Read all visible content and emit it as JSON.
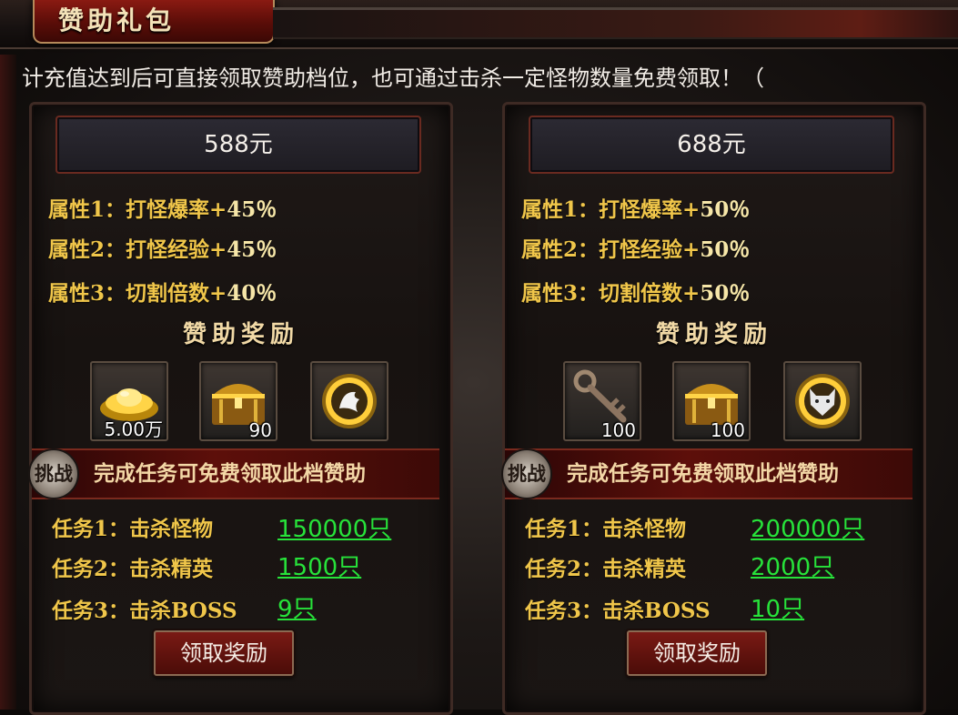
{
  "header": {
    "title": "赞助礼包"
  },
  "notice": "计充值达到后可直接领取赞助档位，也可通过击杀一定怪物数量免费领取！（",
  "tiers": [
    {
      "price": "588元",
      "attrs": [
        {
          "label": "属性1：打怪爆率+",
          "value": "45％"
        },
        {
          "label": "属性2：打怪经验+",
          "value": "45％"
        },
        {
          "label": "属性3：切割倍数+",
          "value": "40％"
        }
      ],
      "reward_title": "赞助奖励",
      "items": [
        {
          "icon": "gold-ingot-icon",
          "count": "5.00万"
        },
        {
          "icon": "treasure-chest-icon",
          "count": "90"
        },
        {
          "icon": "golden-medal-icon",
          "count": ""
        }
      ],
      "challenge_badge": "挑战",
      "challenge_text": "完成任务可免费领取此档赞助",
      "tasks": [
        {
          "label": "任务1：击杀怪物",
          "value": "150000只"
        },
        {
          "label": "任务2：击杀精英",
          "value": "1500只"
        },
        {
          "label": "任务3：击杀BOSS",
          "value": "9只"
        }
      ],
      "claim_label": "领取奖励"
    },
    {
      "price": "688元",
      "attrs": [
        {
          "label": "属性1：打怪爆率+",
          "value": "50％"
        },
        {
          "label": "属性2：打怪经验+",
          "value": "50％"
        },
        {
          "label": "属性3：切割倍数+",
          "value": "50％"
        }
      ],
      "reward_title": "赞助奖励",
      "items": [
        {
          "icon": "key-icon",
          "count": "100"
        },
        {
          "icon": "treasure-chest-icon",
          "count": "100"
        },
        {
          "icon": "wolf-medal-icon",
          "count": ""
        }
      ],
      "challenge_badge": "挑战",
      "challenge_text": "完成任务可免费领取此档赞助",
      "tasks": [
        {
          "label": "任务1：击杀怪物",
          "value": "200000只"
        },
        {
          "label": "任务2：击杀精英",
          "value": "2000只"
        },
        {
          "label": "任务3：击杀BOSS",
          "value": "10只"
        }
      ],
      "claim_label": "领取奖励"
    }
  ],
  "colors": {
    "task_value": "#27e23a",
    "attr_text": "#f0c64a",
    "accent_red": "#5d0f0a"
  }
}
